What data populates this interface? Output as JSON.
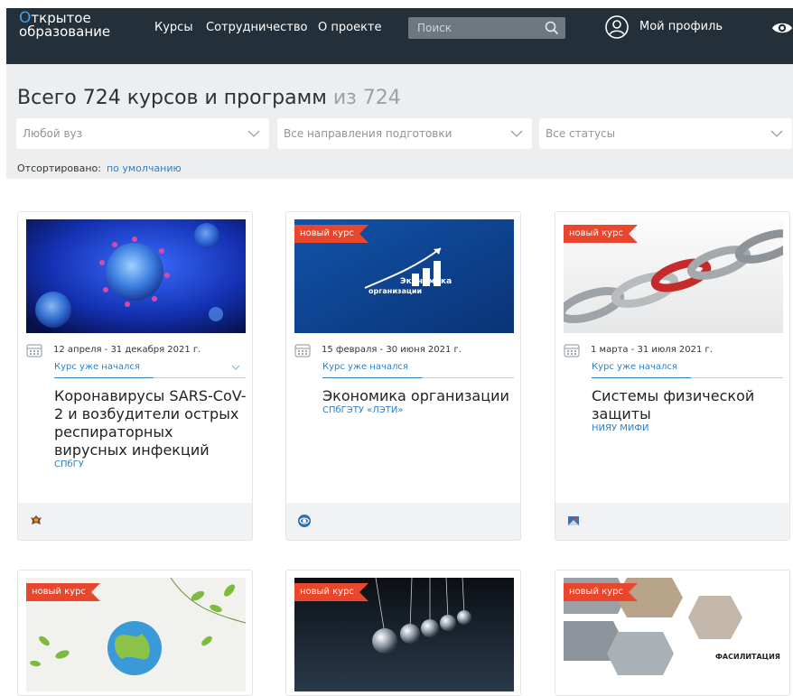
{
  "header": {
    "logo_line1_first": "О",
    "logo_line1_rest": "ткрытое",
    "logo_line2": "образование",
    "nav": [
      "Курсы",
      "Сотрудничество",
      "О проекте"
    ],
    "search_placeholder": "Поиск",
    "profile_label": "Мой профиль"
  },
  "filters": {
    "total_prefix": "Всего 724 курсов и программ",
    "total_suffix": "из 724",
    "selects": [
      "Любой вуз",
      "Все направления подготовки",
      "Все статусы"
    ],
    "sorted_label": "Отсортировано:",
    "sorted_value": "по умолчанию"
  },
  "cards": [
    {
      "badge": "",
      "dates": "12 апреля - 31 декабря 2021 г.",
      "status": "Курс уже начался",
      "title": "Коронавирусы SARS-CoV-2 и возбудители острых респираторных вирусных инфекций",
      "university": "СПбГУ"
    },
    {
      "badge": "новый курс",
      "dates": "15 февраля - 30 июня 2021 г.",
      "status": "Курс уже начался",
      "title": "Экономика организации",
      "university": "СПбГЭТУ «ЛЭТИ»",
      "image_text_1": "Экономика",
      "image_text_2": "организации"
    },
    {
      "badge": "новый курс",
      "dates": "1 марта - 31 июля 2021 г.",
      "status": "Курс уже начался",
      "title": "Системы физической защиты",
      "university": "НИЯУ МИФИ"
    },
    {
      "badge": "новый курс"
    },
    {
      "badge": "новый курс"
    },
    {
      "badge": "новый курс",
      "image_text": "ФАСИЛИТАЦИЯ"
    }
  ],
  "colors": {
    "header_bg": "#243039",
    "accent_blue": "#2f7fc1",
    "badge_red": "#e8472d",
    "panel_bg": "#eceeef"
  }
}
